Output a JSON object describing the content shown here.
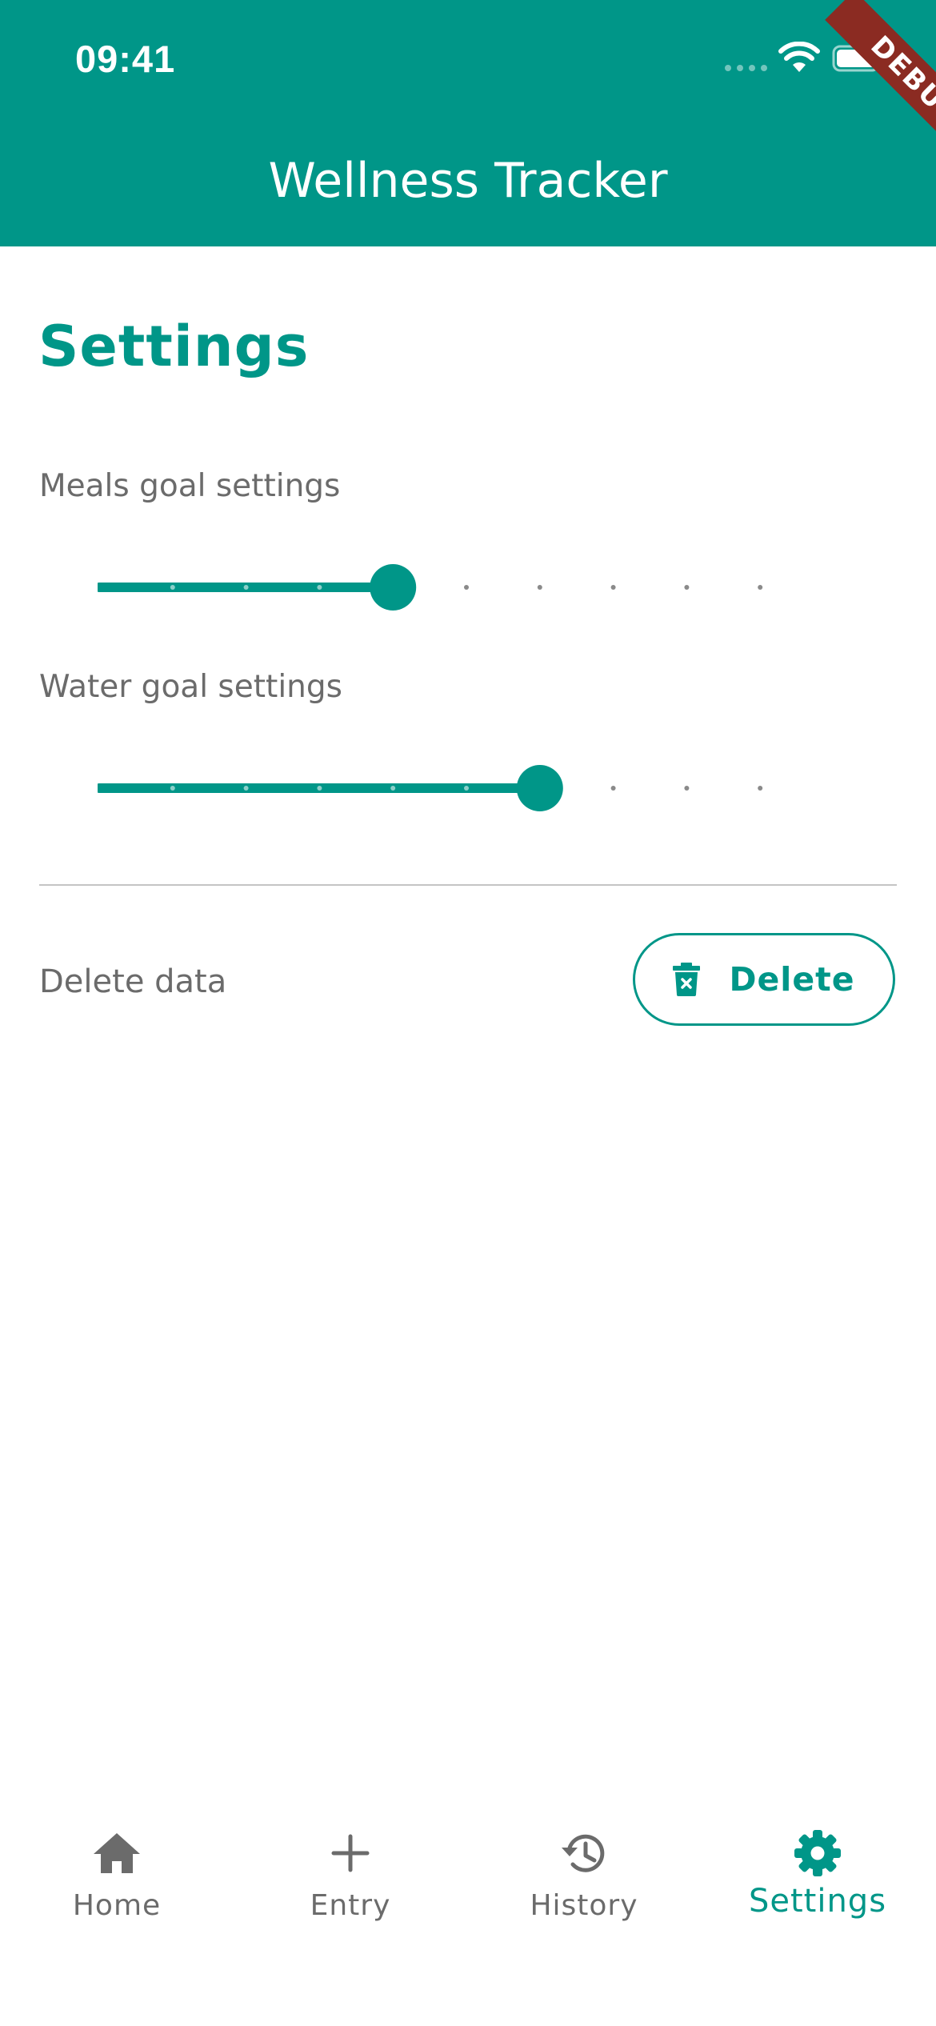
{
  "status_bar": {
    "time": "09:41"
  },
  "debug_banner": "DEBUG",
  "appbar": {
    "title": "Wellness Tracker"
  },
  "page": {
    "heading": "Settings"
  },
  "settings": {
    "meals": {
      "label": "Meals goal settings",
      "value": 4,
      "max": 10
    },
    "water": {
      "label": "Water goal settings",
      "value": 6,
      "max": 10
    }
  },
  "delete_row": {
    "label": "Delete data",
    "button_label": "Delete"
  },
  "bottom_nav": {
    "items": [
      {
        "label": "Home",
        "icon": "home-icon",
        "active": false
      },
      {
        "label": "Entry",
        "icon": "plus-icon",
        "active": false
      },
      {
        "label": "History",
        "icon": "history-icon",
        "active": false
      },
      {
        "label": "Settings",
        "icon": "gear-icon",
        "active": true
      }
    ]
  },
  "colors": {
    "primary": "#009688",
    "text_secondary": "#6b6b6b",
    "debug_banner": "#8b2b22"
  }
}
